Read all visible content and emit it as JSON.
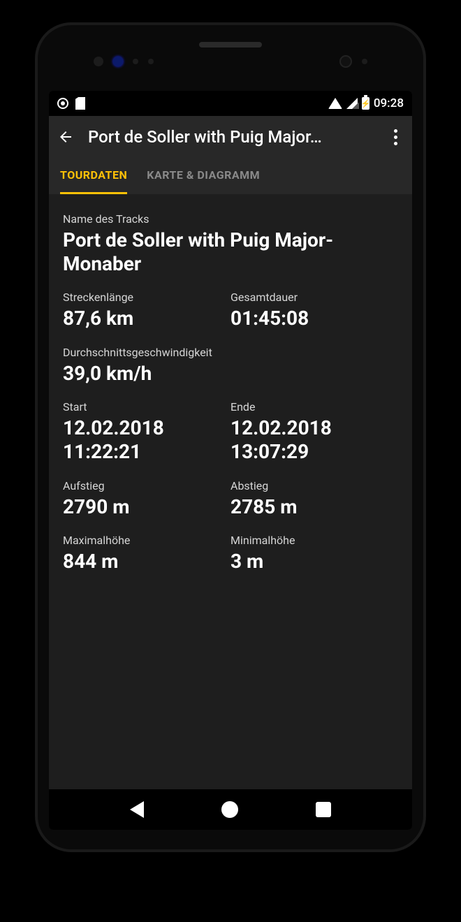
{
  "statusbar": {
    "time": "09:28",
    "battery_glyph": "⚡"
  },
  "appbar": {
    "title": "Port de Soller with Puig Major…"
  },
  "tabs": {
    "data": "TOURDATEN",
    "map": "KARTE & DIAGRAMM"
  },
  "labels": {
    "track_name": "Name des Tracks",
    "distance": "Streckenlänge",
    "duration": "Gesamtdauer",
    "avg_speed": "Durchschnittsgeschwindigkeit",
    "start": "Start",
    "end": "Ende",
    "ascent": "Aufstieg",
    "descent": "Abstieg",
    "max_alt": "Maximalhöhe",
    "min_alt": "Minimalhöhe"
  },
  "values": {
    "track_name": "Port de Soller with Puig Major-Monaber",
    "distance": "87,6 km",
    "duration": "01:45:08",
    "avg_speed": "39,0 km/h",
    "start": "12.02.2018 11:22:21",
    "end": "12.02.2018 13:07:29",
    "ascent": "2790 m",
    "descent": "2785 m",
    "max_alt": "844 m",
    "min_alt": "3 m"
  }
}
